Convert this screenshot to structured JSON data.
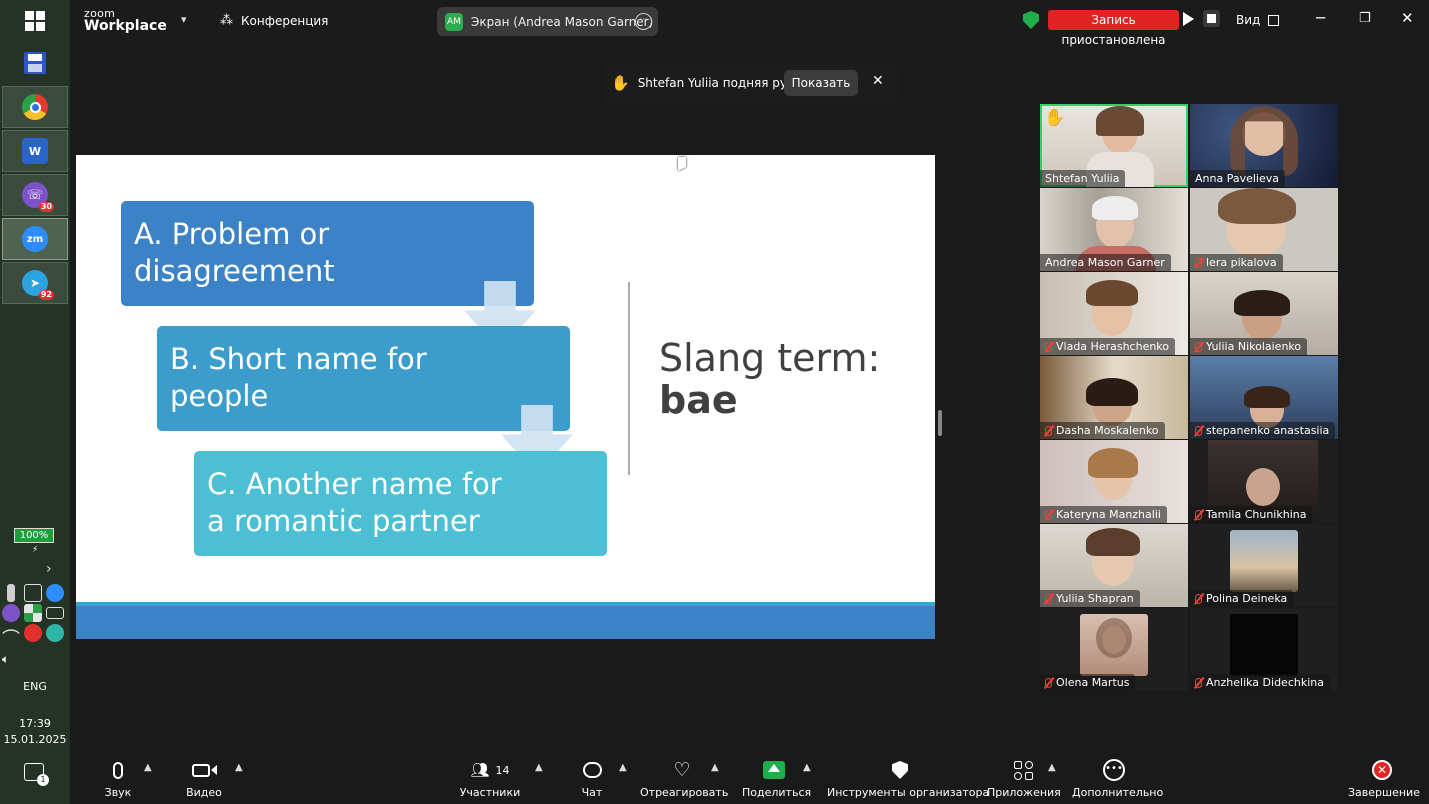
{
  "taskbar": {
    "battery": "100%",
    "lang": "ENG",
    "time": "17:39",
    "date": "15.01.2025",
    "viber_badge": "30",
    "telegram_badge": "92",
    "notif_count": "1",
    "zoom_icon_label": "zm"
  },
  "titlebar": {
    "logo_top": "zoom",
    "logo_bottom": "Workplace",
    "conference": "Конференция",
    "screen_initials": "AM",
    "screen_label": "Экран (Andrea Mason Garner)",
    "recording": "Запись приостановлена",
    "view": "Вид"
  },
  "raise_hand": {
    "text": "Shtefan Yuliia подняя руку",
    "show": "Показать"
  },
  "slide": {
    "box_a_line1": "A. Problem or",
    "box_a_line2": "disagreement",
    "box_b_line1": "B. Short name for",
    "box_b_line2": "people",
    "box_c_line1": "C. Another name for",
    "box_c_line2": "a romantic partner",
    "slang_line1": "Slang term:",
    "slang_line2": "bae"
  },
  "participants": [
    {
      "name": "Shtefan Yuliia",
      "muted": false,
      "hand": true,
      "speaking": true
    },
    {
      "name": "Anna Pavelieva",
      "muted": false
    },
    {
      "name": "Andrea Mason Garner",
      "muted": false
    },
    {
      "name": "lera pikalova",
      "muted": true
    },
    {
      "name": "Vlada Herashchenko",
      "muted": true
    },
    {
      "name": "Yuliia Nikolaienko",
      "muted": true
    },
    {
      "name": "Dasha Moskalenko",
      "muted": true
    },
    {
      "name": "stepanenko anastasiia",
      "muted": true
    },
    {
      "name": "Kateryna Manzhalii",
      "muted": true
    },
    {
      "name": "Tamila Chunikhina",
      "muted": true
    },
    {
      "name": "Yuliia Shapran",
      "muted": true
    },
    {
      "name": "Polina Deineka",
      "muted": true
    },
    {
      "name": "Olena Martus",
      "muted": true
    },
    {
      "name": "Anzhelika Didechkina",
      "muted": true
    }
  ],
  "controls": {
    "audio": "Звук",
    "video": "Видео",
    "participants": "Участники",
    "participants_count": "14",
    "chat": "Чат",
    "react": "Отреагировать",
    "share": "Поделиться",
    "host_tools": "Инструменты организатора",
    "apps": "Приложения",
    "more": "Дополнительно",
    "end": "Завершение"
  },
  "colors": {
    "box_a": "#3c82c6",
    "box_b": "#3c9dcc",
    "box_c": "#4cbfd4",
    "recording": "#e02424",
    "share": "#1fae4b",
    "speaking_border": "#2ed36a"
  }
}
